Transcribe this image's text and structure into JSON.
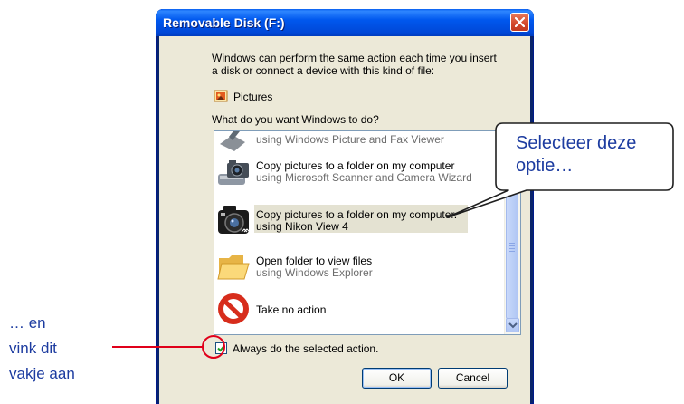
{
  "window": {
    "title": "Removable Disk (F:)"
  },
  "dialog": {
    "description_line1": "Windows can perform the same action each time you insert",
    "description_line2": "a disk or connect a device with this kind of file:",
    "content_type": "Pictures",
    "question": "What do you want Windows to do?"
  },
  "actions": [
    {
      "line1": "",
      "line2": "using Windows Picture and Fax Viewer",
      "icon": "picture-viewer-icon"
    },
    {
      "line1": "Copy pictures to a folder on my computer",
      "line2": "using Microsoft Scanner and Camera Wizard",
      "icon": "scanner-camera-icon"
    },
    {
      "line1": "Copy pictures to a folder on my computer.",
      "line2": "using Nikon View 4",
      "icon": "nikon-camera-icon",
      "selected": true
    },
    {
      "line1": "Open folder to view files",
      "line2": "using Windows Explorer",
      "icon": "folder-icon"
    },
    {
      "line1": "Take no action",
      "line2": "",
      "icon": "no-action-icon"
    }
  ],
  "always_checkbox": {
    "label": "Always do the selected action.",
    "checked": true
  },
  "buttons": {
    "ok": "OK",
    "cancel": "Cancel"
  },
  "annotations": {
    "callout_line1": "Selecteer deze",
    "callout_line2": "optie…",
    "left_line1": "… en",
    "left_line2": "vink dit",
    "left_line3": "vakje aan",
    "accent_color": "#1d3ca0",
    "marker_color": "#e0001a"
  }
}
